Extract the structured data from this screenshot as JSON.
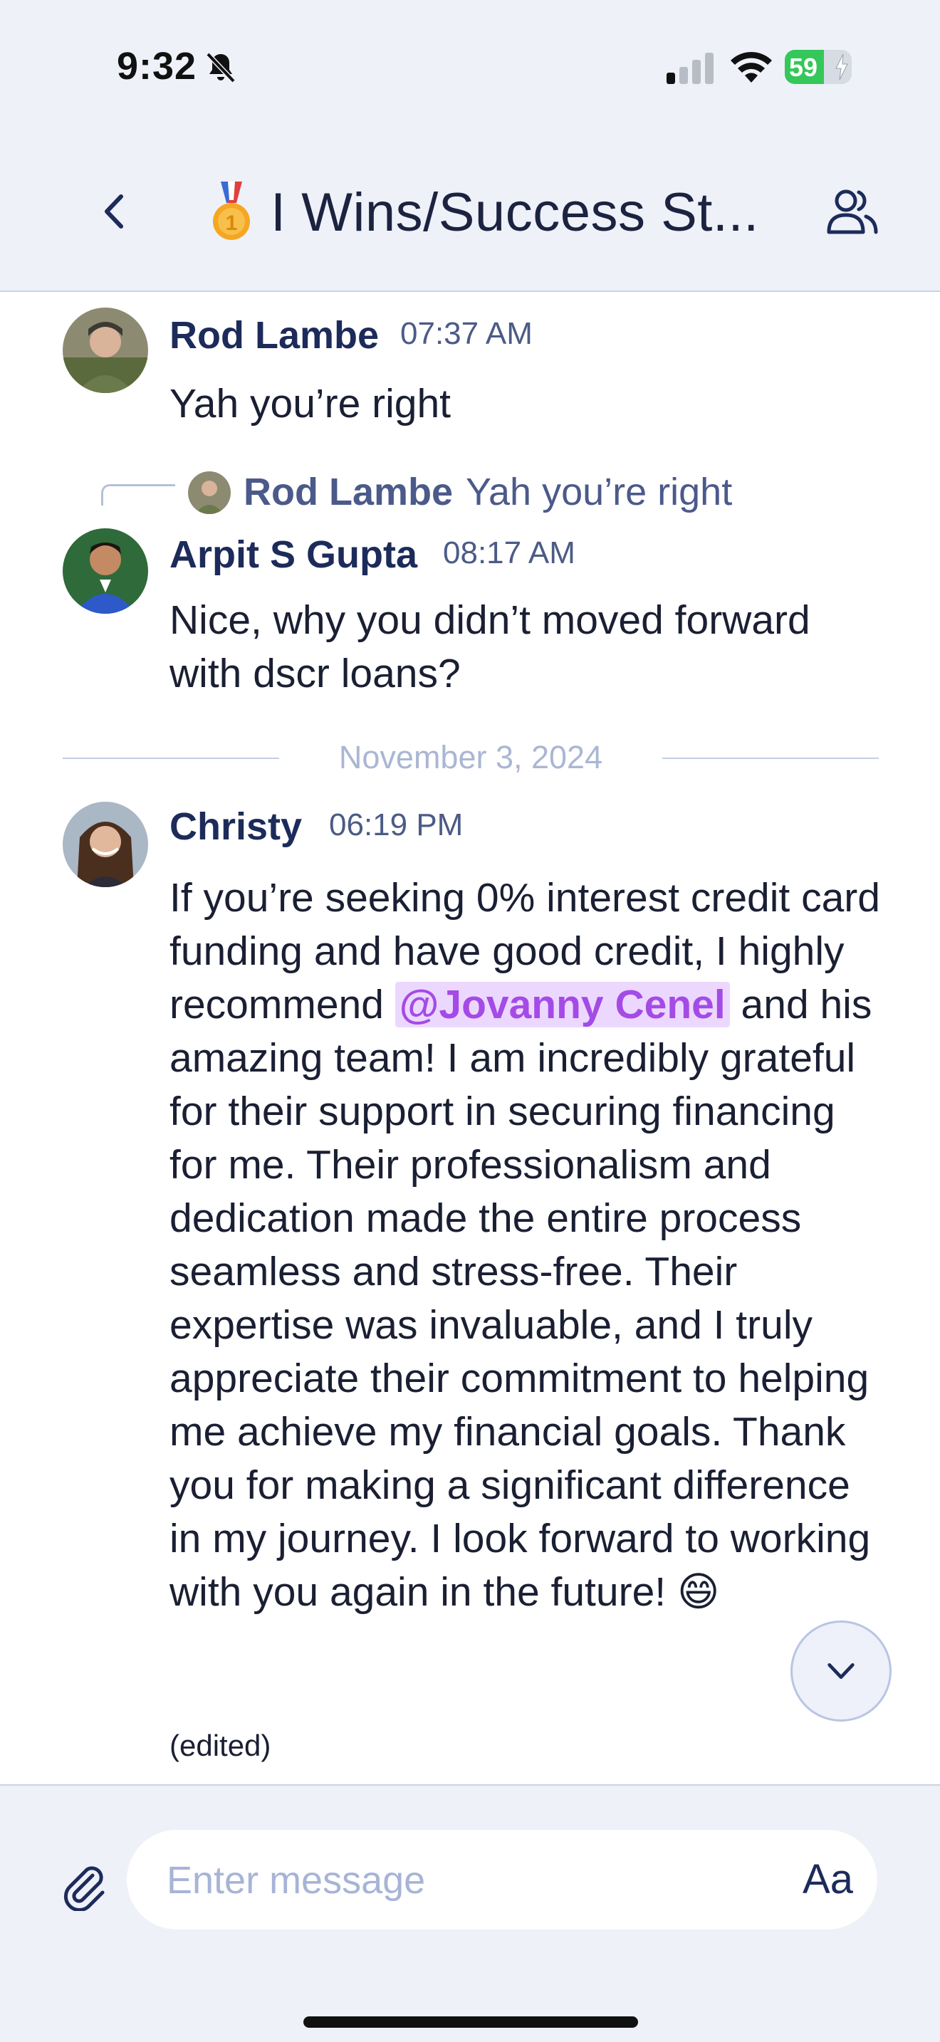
{
  "status_bar": {
    "time": "9:32",
    "battery": "59",
    "battery_level": 0.59
  },
  "header": {
    "title": "I Wins/Success St..."
  },
  "messages": [
    {
      "author": "Rod Lambe",
      "time": "07:37 AM",
      "text": "Yah you’re right"
    },
    {
      "reply_to": {
        "author": "Rod Lambe",
        "text": "Yah you’re right"
      },
      "author": "Arpit S Gupta",
      "time": "08:17 AM",
      "text": "Nice, why you didn’t moved forward with dscr loans?"
    }
  ],
  "date_separator": "November 3, 2024",
  "christy_message": {
    "author": "Christy",
    "time": "06:19 PM",
    "text_before_mention": "If you’re seeking 0% interest credit card funding and have good credit, I highly recommend ",
    "mention": "@Jovanny Cenel",
    "text_after_mention": " and his amazing team! I am incredibly grateful for their support in securing financing for me. Their professionalism and dedication made the entire process seamless and stress-free. Their expertise was invaluable, and I truly appreciate their commitment to helping me achieve my financial goals. Thank you for making a significant difference in my journey. I look forward to working with you again in the future! 😄",
    "edited_label": "(edited)"
  },
  "composer": {
    "placeholder": "Enter message",
    "format_label": "Aa"
  },
  "colors": {
    "accent": "#1c2b5a",
    "mention_bg": "#ecd8ff",
    "mention_text": "#a44be6",
    "battery_green": "#34c759"
  },
  "icons": [
    "bell-off-icon",
    "signal-icon",
    "wifi-icon",
    "back-icon",
    "medal-icon",
    "members-icon",
    "chevron-down-icon",
    "paperclip-icon"
  ]
}
